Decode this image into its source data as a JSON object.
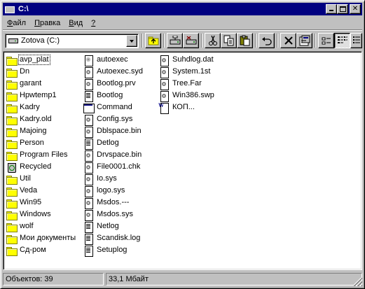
{
  "window": {
    "title": "C:\\"
  },
  "menu": [
    {
      "label": "Файл",
      "accel": "Ф",
      "rest": "айл"
    },
    {
      "label": "Правка",
      "accel": "П",
      "rest": "равка"
    },
    {
      "label": "Вид",
      "accel": "В",
      "rest": "ид"
    },
    {
      "label": "?",
      "accel": "?",
      "rest": ""
    }
  ],
  "toolbar": {
    "drive": "Zotova (C:)",
    "buttons": [
      "up-folder",
      "map-drive",
      "disconnect-drive",
      "cut",
      "copy",
      "paste",
      "undo",
      "delete",
      "properties",
      "small-icons",
      "list"
    ]
  },
  "files": {
    "col1": [
      {
        "name": "avp_plat",
        "icon": "folder",
        "focused": true
      },
      {
        "name": "Dn",
        "icon": "folder"
      },
      {
        "name": "garant",
        "icon": "folder"
      },
      {
        "name": "Hpwtemp1",
        "icon": "folder"
      },
      {
        "name": "Kadry",
        "icon": "folder"
      },
      {
        "name": "Kadry.old",
        "icon": "folder"
      },
      {
        "name": "Majoing",
        "icon": "folder"
      },
      {
        "name": "Person",
        "icon": "folder"
      },
      {
        "name": "Program Files",
        "icon": "folder"
      },
      {
        "name": "Recycled",
        "icon": "recycle"
      },
      {
        "name": "Util",
        "icon": "folder"
      },
      {
        "name": "Veda",
        "icon": "folder"
      },
      {
        "name": "Win95",
        "icon": "folder"
      },
      {
        "name": "Windows",
        "icon": "folder"
      },
      {
        "name": "wolf",
        "icon": "folder"
      },
      {
        "name": "Мои документы",
        "icon": "folder"
      },
      {
        "name": "Сд-ром",
        "icon": "folder"
      }
    ],
    "col2": [
      {
        "name": "autoexec",
        "icon": "batch"
      },
      {
        "name": "Autoexec.syd",
        "icon": "sys"
      },
      {
        "name": "Bootlog.prv",
        "icon": "sys"
      },
      {
        "name": "Bootlog",
        "icon": "doc"
      },
      {
        "name": "Command",
        "icon": "exe"
      },
      {
        "name": "Config.sys",
        "icon": "sys"
      },
      {
        "name": "Dblspace.bin",
        "icon": "sys"
      },
      {
        "name": "Detlog",
        "icon": "doc"
      },
      {
        "name": "Drvspace.bin",
        "icon": "sys"
      },
      {
        "name": "File0001.chk",
        "icon": "sys"
      },
      {
        "name": "Io.sys",
        "icon": "sys"
      },
      {
        "name": "logo.sys",
        "icon": "sys"
      },
      {
        "name": "Msdos.---",
        "icon": "sys"
      },
      {
        "name": "Msdos.sys",
        "icon": "sys"
      },
      {
        "name": "Netlog",
        "icon": "doc"
      },
      {
        "name": "Scandisk.log",
        "icon": "doc"
      },
      {
        "name": "Setuplog",
        "icon": "doc"
      }
    ],
    "col3": [
      {
        "name": "Suhdlog.dat",
        "icon": "sys"
      },
      {
        "name": "System.1st",
        "icon": "sys"
      },
      {
        "name": "Tree.Far",
        "icon": "sys"
      },
      {
        "name": "Win386.swp",
        "icon": "sys"
      },
      {
        "name": "КОП...",
        "icon": "word"
      }
    ]
  },
  "status": {
    "objects": "Объектов: 39",
    "size": "33,1 Мбайт"
  }
}
